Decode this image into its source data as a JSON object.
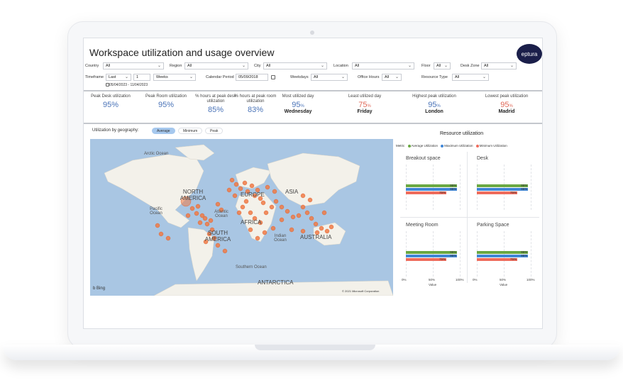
{
  "title": "Workspace utilization and usage overview",
  "logo_text": "eptura",
  "filters": {
    "country_label": "Country",
    "country_value": "All",
    "region_label": "Region",
    "region_value": "All",
    "city_label": "City",
    "city_value": "All",
    "location_label": "Location",
    "location_value": "All",
    "floor_label": "Floor",
    "floor_value": "All",
    "deskzone_label": "Desk Zone",
    "deskzone_value": "All",
    "timeframe_label": "Timeframe",
    "timeframe_value": "Last",
    "timeframe_number": "1",
    "timeframe_unit": "Weeks",
    "calendar_label": "Calendar Period",
    "calendar_value": "05/09/2018",
    "weekdays_label": "Weekdays",
    "weekdays_value": "All",
    "officehours_label": "Office Hours",
    "officehours_value": "All",
    "resourcetype_label": "Resource Type",
    "resourcetype_value": "All",
    "date_range": "05/04/2023 - 11/04/2023"
  },
  "kpis": [
    {
      "label": "Peak Desk utilization",
      "value": "95%"
    },
    {
      "label": "Peak Room utilization",
      "value": "95%"
    },
    {
      "label": "% hours at peak desk utilization",
      "value": "85%"
    },
    {
      "label": "% hours at peak room utilization",
      "value": "83%"
    },
    {
      "label": "Most utilized day",
      "value": "95",
      "unit": "%",
      "sub": "Wednesday"
    },
    {
      "label": "Least utilized day",
      "value": "75",
      "unit": "%",
      "sub": "Friday"
    },
    {
      "label": "Highest peak utilization",
      "value": "95",
      "unit": "%",
      "sub": "London"
    },
    {
      "label": "Lowest peak utilization",
      "value": "95",
      "unit": "%",
      "sub": "Madrid"
    }
  ],
  "geo": {
    "label": "Utilization by geography:",
    "options": [
      "Average",
      "Minimum",
      "Peak"
    ],
    "selected": "Average"
  },
  "map": {
    "labels": {
      "arctic": "Arctic Ocean",
      "north_america": "NORTH AMERICA",
      "europe": "EUROPE",
      "asia": "ASIA",
      "africa": "AFRICA",
      "south_america": "SOUTH AMERICA",
      "australia": "AUSTRALIA",
      "pacific": "Pacific Ocean",
      "atlantic": "Atlantic Ocean",
      "indian": "Indian Ocean",
      "southern": "Southern Ocean",
      "antarctica": "ANTARCTICA"
    },
    "provider": "Bing",
    "copyright": "© 2021 Microsoft Corporation",
    "marker_color": "#f07a45"
  },
  "resource": {
    "title": "Resource utilization",
    "legend_title": "Metric",
    "metrics": [
      {
        "name": "Average Utilization",
        "color": "#6aa842"
      },
      {
        "name": "Maximum Utilization",
        "color": "#3f86d6"
      },
      {
        "name": "Minimum Utilization",
        "color": "#ef6b5b"
      }
    ],
    "panels": [
      {
        "name": "Breakout space",
        "values": [
          95,
          95,
          75
        ],
        "labels": [
          "95%",
          "95%",
          "75%"
        ]
      },
      {
        "name": "Desk",
        "values": [
          95,
          95,
          75
        ],
        "labels": [
          "95%",
          "95%",
          "75%"
        ]
      },
      {
        "name": "Meeting Room",
        "values": [
          95,
          95,
          75
        ],
        "labels": [
          "95%",
          "95%",
          "75%"
        ]
      },
      {
        "name": "Parking Space",
        "values": [
          95,
          95,
          75
        ],
        "labels": [
          "95%",
          "95%",
          "75%"
        ]
      }
    ],
    "x_ticks": [
      "0%",
      "50%",
      "100%"
    ],
    "x_label": "Value"
  }
}
